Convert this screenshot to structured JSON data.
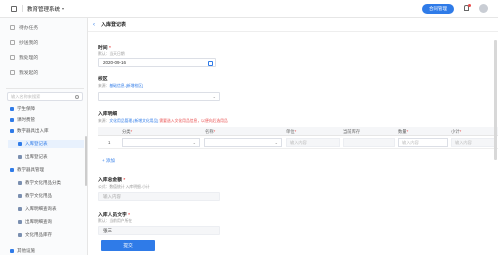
{
  "app": {
    "title": "教育管理系统",
    "admin_button": "合同管理"
  },
  "sidebar": {
    "quick": [
      {
        "label": "待办任务",
        "icon": "task-icon"
      },
      {
        "label": "抄送我的",
        "icon": "cc-icon"
      },
      {
        "label": "我处理的",
        "icon": "handled-icon"
      },
      {
        "label": "我发起的",
        "icon": "initiated-icon"
      }
    ],
    "search_placeholder": "输入名称来搜索",
    "menu": [
      {
        "label": "学生保障",
        "level": 1
      },
      {
        "label": "课时费管",
        "level": 1
      },
      {
        "label": "数字器具出入库",
        "level": 1
      },
      {
        "label": "入库登记表",
        "level": 2,
        "active": true
      },
      {
        "label": "出库登记表",
        "level": 2
      },
      {
        "label": "教学器具管理",
        "level": 1
      },
      {
        "label": "教学文化用品分类",
        "level": 2
      },
      {
        "label": "教学文化用品",
        "level": 2
      },
      {
        "label": "入库明细查询表",
        "level": 2
      },
      {
        "label": "出库明细查询",
        "level": 2
      },
      {
        "label": "文化用品库存",
        "level": 2
      },
      {
        "label": "其他设施",
        "level": 1
      }
    ]
  },
  "page": {
    "title": "入库登记表"
  },
  "form": {
    "time": {
      "label": "时间",
      "hint": "默认：当天日期",
      "value": "2020-09-16"
    },
    "campus": {
      "label": "校区",
      "hint_prefix": "来源：",
      "hint_link": "基础信息-[新增校区]",
      "value": ""
    },
    "detail": {
      "label": "入库明细",
      "hint_prefix": "来源：",
      "hint_link": "文化用品管理-[新增文化用品]",
      "hint_red": "需要选入文化用品信息，以便向后选用品",
      "columns": [
        {
          "label": "分类",
          "required": true
        },
        {
          "label": "名称",
          "required": true
        },
        {
          "label": "单位",
          "required": true
        },
        {
          "label": "当前库存",
          "required": false
        },
        {
          "label": "数量",
          "required": true
        },
        {
          "label": "小计",
          "required": true
        }
      ],
      "rows": [
        {
          "index": "1",
          "classify": "",
          "name": "",
          "unit": "输入内容",
          "stock": "",
          "quantity": "输入内容",
          "subtotal": "输入内容"
        }
      ],
      "add_label": "+ 添加"
    },
    "total": {
      "label": "入库总金额",
      "hint": "公式：数值统计 入库明细-小计",
      "placeholder": "输入内容"
    },
    "operator": {
      "label": "入库人员文字",
      "hint": "默认：当前用户所在",
      "value": "张三"
    },
    "submit_label": "提交"
  }
}
